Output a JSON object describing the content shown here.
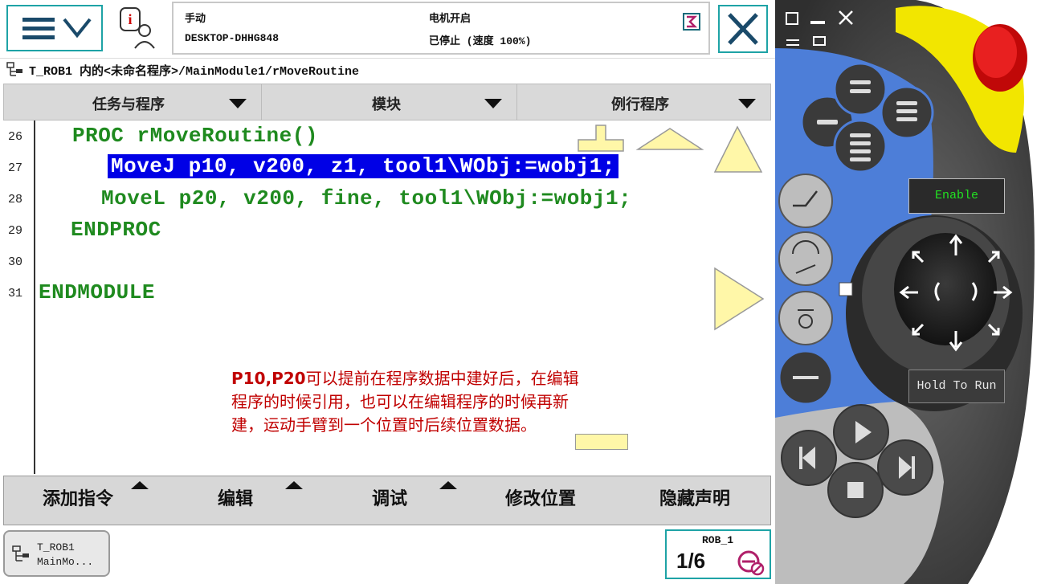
{
  "status": {
    "mode": "手动",
    "controller": "DESKTOP-DHHG848",
    "motor": "电机开启",
    "program_state": "已停止 (速度 100%)"
  },
  "breadcrumb": "T_ROB1 内的<未命名程序>/MainModule1/rMoveRoutine",
  "tabs": [
    {
      "label": "任务与程序"
    },
    {
      "label": "模块"
    },
    {
      "label": "例行程序"
    }
  ],
  "code_lines": [
    {
      "num": "26",
      "text": "PROC rMoveRoutine()"
    },
    {
      "num": "27",
      "text": "MoveJ p10, v200, z1, tool1\\WObj:=wobj1;"
    },
    {
      "num": "28",
      "text": "MoveL p20, v200, fine, tool1\\WObj:=wobj1;"
    },
    {
      "num": "29",
      "text": "ENDPROC"
    },
    {
      "num": "30",
      "text": ""
    },
    {
      "num": "31",
      "text": "ENDMODULE"
    }
  ],
  "annotation": {
    "bold": "P10,P20",
    "line1": "可以提前在程序数据中建好后，在编辑",
    "line2": "程序的时候引用，也可以在编辑程序的时候再新",
    "line3": "建，运动手臂到一个位置时后续位置数据。"
  },
  "toolbar": {
    "add_instruction": "添加指令",
    "edit": "编辑",
    "debug": "调试",
    "modify_position": "修改位置",
    "hide_declarations": "隐藏声明"
  },
  "taskbar": {
    "task_line1": "T_ROB1",
    "task_line2": "MainMo...",
    "rob_label": "ROB_1",
    "rob_fraction": "1/6"
  },
  "pendant": {
    "enable": "Enable",
    "hold_to_run": "Hold To Run"
  },
  "colors": {
    "accent": "#1ea3a6",
    "code_green": "#1f8a1f",
    "selection_blue": "#0000e6",
    "annotation_red": "#c00000",
    "pendant_blue": "#4d7ed8",
    "pendant_yellow": "#f2e600",
    "estop_red": "#e01010"
  }
}
